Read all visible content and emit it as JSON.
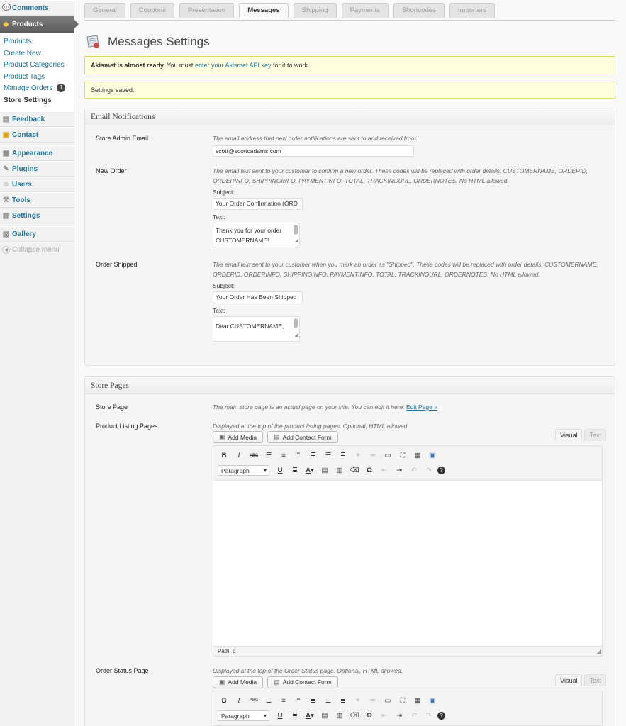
{
  "sidebar": {
    "comments": "Comments",
    "products": "Products",
    "submenu": [
      "Products",
      "Create New",
      "Product Categories",
      "Product Tags",
      "Manage Orders",
      "Store Settings"
    ],
    "orders_badge": "1",
    "feedback": "Feedback",
    "contact": "Contact",
    "appearance": "Appearance",
    "plugins": "Plugins",
    "users": "Users",
    "tools": "Tools",
    "settings": "Settings",
    "gallery": "Gallery",
    "collapse": "Collapse menu"
  },
  "tabs": [
    "General",
    "Coupons",
    "Presentation",
    "Messages",
    "Shipping",
    "Payments",
    "Shortcodes",
    "Importers"
  ],
  "page_title": "Messages Settings",
  "notices": {
    "akismet_bold": "Akismet is almost ready.",
    "akismet_pre": "You must",
    "akismet_link": "enter your Akismet API key",
    "akismet_post": "for it to work.",
    "saved": "Settings saved."
  },
  "email": {
    "heading": "Email Notifications",
    "admin_label": "Store Admin Email",
    "admin_desc": "The email address that new order notifications are sent to and received from.",
    "admin_value": "scott@scottcadams.com",
    "new_label": "New Order",
    "new_desc": "The email text sent to your customer to confirm a new order. These codes will be replaced with order details: CUSTOMERNAME, ORDERID, ORDERINFO, SHIPPINGINFO, PAYMENTINFO, TOTAL, TRACKINGURL, ORDERNOTES. No HTML allowed.",
    "subject_label": "Subject:",
    "text_label": "Text:",
    "new_subject": "Your Order Confirmation (ORD",
    "new_text_1": "Thank you for your order",
    "new_text_2": "CUSTOMERNAME!",
    "shipped_label": "Order Shipped",
    "shipped_desc": "The email text sent to your customer when you mark an order as \"Shipped\". These codes will be replaced with order details: CUSTOMERNAME, ORDERID, ORDERINFO, SHIPPINGINFO, PAYMENTINFO, TOTAL, TRACKINGURL, ORDERNOTES. No HTML allowed.",
    "shipped_subject": "Your Order Has Been Shipped",
    "shipped_text": "Dear CUSTOMERNAME,"
  },
  "pages": {
    "heading": "Store Pages",
    "store_label": "Store Page",
    "store_desc": "The main store page is an actual page on your site. You can edit it here:",
    "store_link": "Edit Page »",
    "listing_label": "Product Listing Pages",
    "listing_desc": "Displayed at the top of the product listing pages. Optional, HTML allowed.",
    "status_label": "Order Status Page",
    "status_desc": "Displayed at the top of the Order Status page. Optional, HTML allowed.",
    "add_media": "Add Media",
    "add_contact": "Add Contact Form",
    "visual": "Visual",
    "text": "Text",
    "paragraph": "Paragraph",
    "path": "Path: p"
  }
}
